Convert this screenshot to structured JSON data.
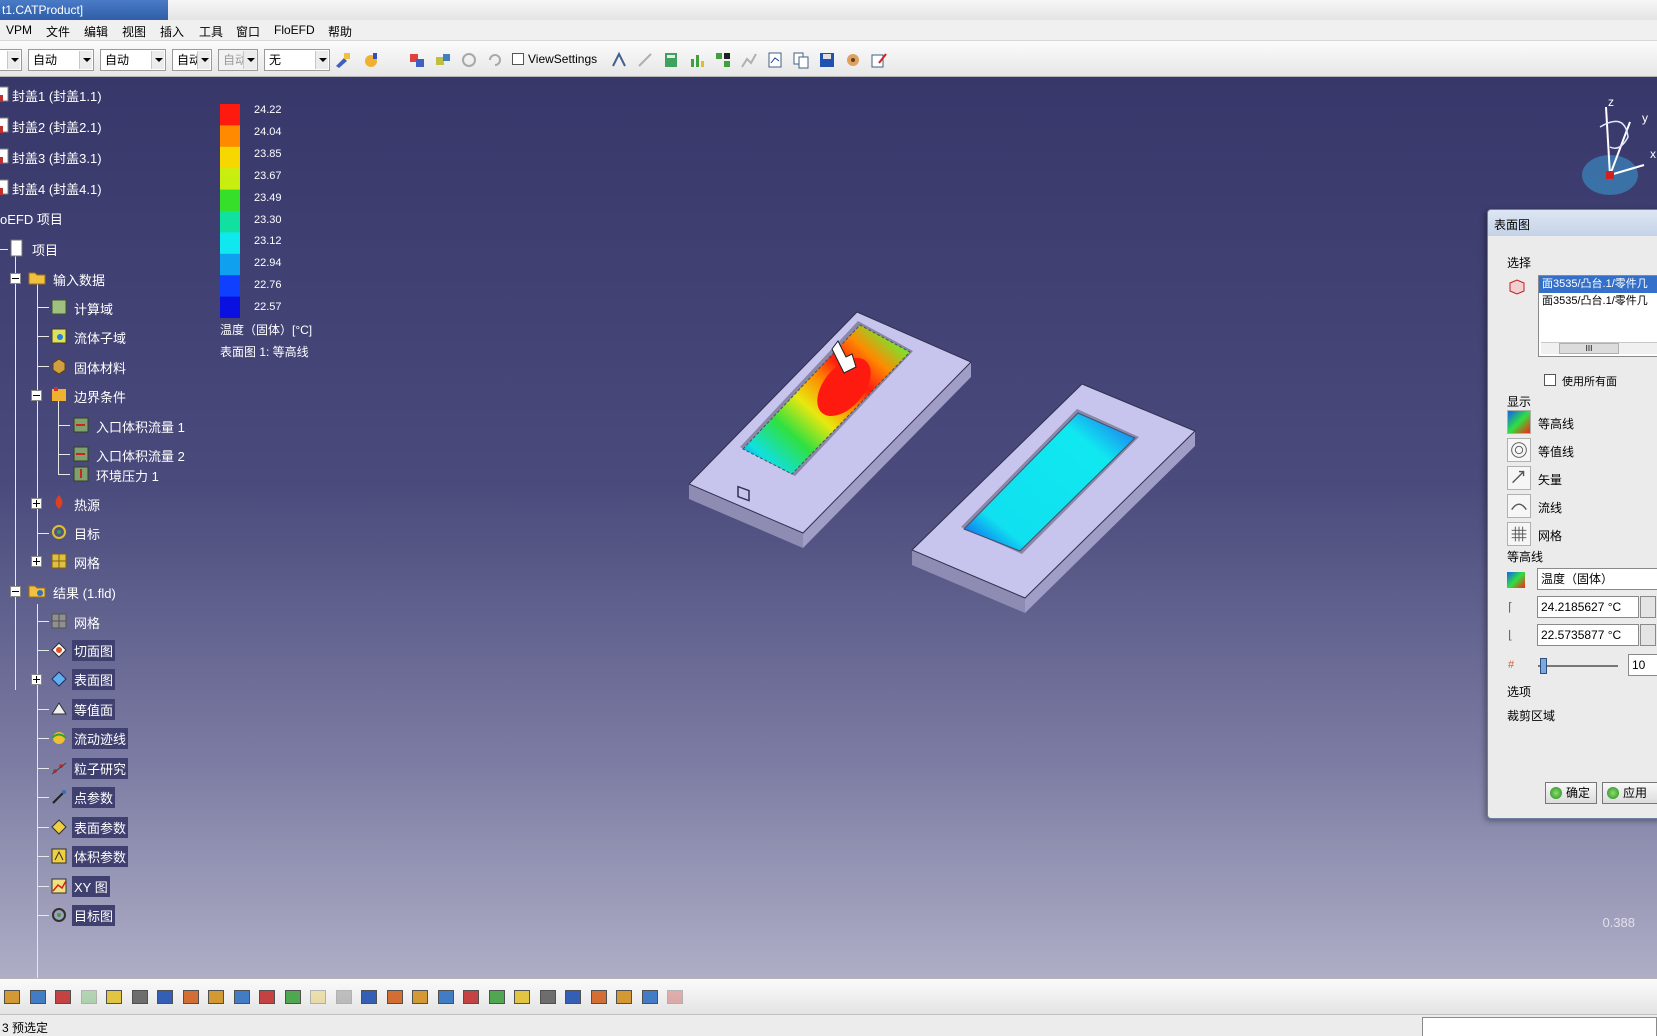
{
  "window": {
    "title": "t1.CATProduct]"
  },
  "menu": [
    "VPM",
    "文件",
    "编辑",
    "视图",
    "插入",
    "工具",
    "窗口",
    "FloEFD",
    "帮助"
  ],
  "toolbar": {
    "combo1": "自动",
    "combo2": "自动",
    "combo3": "自动",
    "combo4": "自动",
    "combo5": "无",
    "view_settings_label": "ViewSettings"
  },
  "tree": {
    "items": [
      "封盖1 (封盖1.1)",
      "封盖2 (封盖2.1)",
      "封盖3 (封盖3.1)",
      "封盖4 (封盖4.1)",
      "oEFD 项目",
      "项目",
      "输入数据",
      "计算域",
      "流体子域",
      "固体材料",
      "边界条件",
      "入口体积流量 1",
      "入口体积流量 2",
      "环境压力 1",
      "热源",
      "目标",
      "网格",
      "结果 (1.fld)",
      "网格",
      "切面图",
      "表面图",
      "等值面",
      "流动迹线",
      "粒子研究",
      "点参数",
      "表面参数",
      "体积参数",
      "XY 图",
      "目标图"
    ]
  },
  "legend": {
    "values": [
      "24.22",
      "24.04",
      "23.85",
      "23.67",
      "23.49",
      "23.30",
      "23.12",
      "22.94",
      "22.76",
      "22.57"
    ],
    "colors": [
      "#ff1a10",
      "#ff8a00",
      "#f6d800",
      "#c8ee10",
      "#36e02a",
      "#10e0a0",
      "#10e8f0",
      "#10a0f0",
      "#1040ff",
      "#0a10e0"
    ],
    "quantity": "温度（固体）[°C]",
    "plot_name": "表面图 1: 等高线"
  },
  "triad": {
    "z": "z",
    "y": "y",
    "x": "x"
  },
  "zoom_value": "0.388",
  "dialog": {
    "title": "表面图",
    "section_select": "选择",
    "selection_rows": [
      "面3535/凸台.1/零件几",
      "面3535/凸台.1/零件几"
    ],
    "scroll_marker": "III",
    "use_all_faces": "使用所有面",
    "section_display": "显示",
    "display_items": [
      "等高线",
      "等值线",
      "矢量",
      "流线",
      "网格"
    ],
    "section_contours": "等高线",
    "parameter": "温度（固体）",
    "max_value": "24.2185627 °C",
    "min_value": "22.5735877 °C",
    "levels": "10",
    "section_options": "选项",
    "section_clip": "裁剪区域",
    "ok_button": "确定",
    "apply_button": "应用"
  },
  "status": {
    "text": "3 预选定"
  }
}
